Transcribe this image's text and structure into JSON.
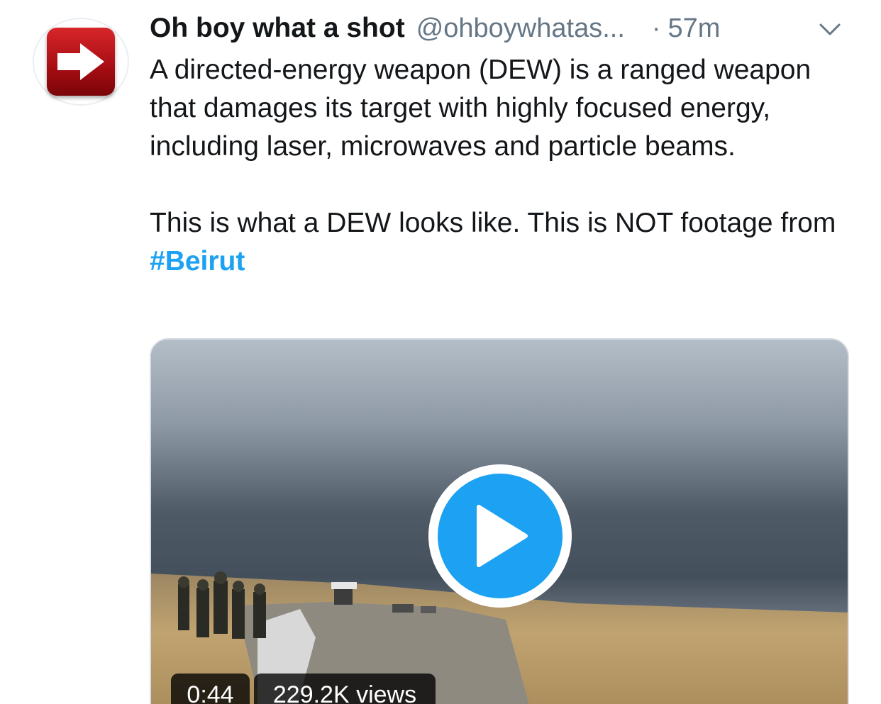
{
  "tweet": {
    "display_name": "Oh boy what a shot",
    "handle": "@ohboywhatas...",
    "separator": "·",
    "time": "57m",
    "text_paragraph_1": "A directed-energy weapon (DEW) is a ranged weapon that damages its target with highly focused energy, including laser, microwaves and particle beams.",
    "text_paragraph_2_prefix": "This is what a DEW looks like. This is NOT footage from",
    "hashtag": "#Beirut"
  },
  "avatar": {
    "icon": "right-arrow-icon",
    "color": "#c4161c"
  },
  "media": {
    "type": "video",
    "duration": "0:44",
    "views": "229.2K views",
    "play_icon": "play-icon"
  },
  "colors": {
    "accent": "#1da1f2",
    "text": "#14171a",
    "secondary_text": "#657786"
  }
}
